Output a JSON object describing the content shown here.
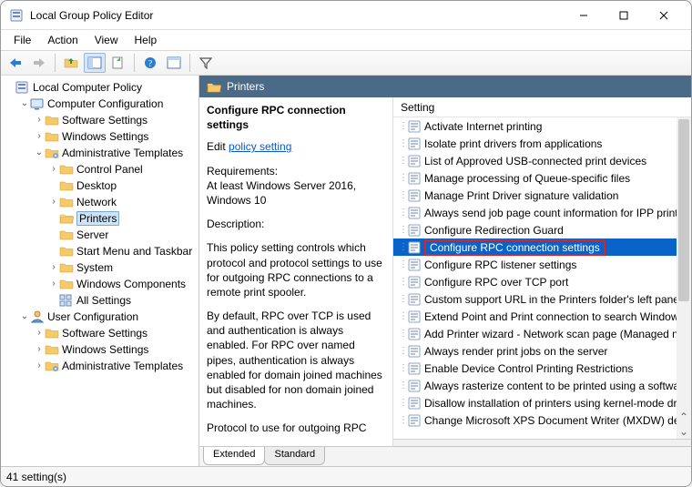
{
  "window": {
    "title": "Local Group Policy Editor"
  },
  "menu": {
    "items": [
      "File",
      "Action",
      "View",
      "Help"
    ]
  },
  "tree": {
    "root": "Local Computer Policy",
    "cc": "Computer Configuration",
    "cc_children": [
      "Software Settings",
      "Windows Settings"
    ],
    "at": "Administrative Templates",
    "at_children": [
      "Control Panel",
      "Desktop",
      "Network",
      "Printers",
      "Server",
      "Start Menu and Taskbar",
      "System",
      "Windows Components",
      "All Settings"
    ],
    "uc": "User Configuration",
    "uc_children": [
      "Software Settings",
      "Windows Settings",
      "Administrative Templates"
    ]
  },
  "header": {
    "path": "Printers"
  },
  "description": {
    "title": "Configure RPC connection settings",
    "edit_prefix": "Edit ",
    "edit_link": "policy setting",
    "req_label": "Requirements:",
    "req_text": "At least Windows Server 2016, Windows 10",
    "desc_label": "Description:",
    "p1": "This policy setting controls which protocol and protocol settings to use for outgoing RPC connections to a remote print spooler.",
    "p2": "By default, RPC over TCP is used and authentication is always enabled. For RPC over named pipes, authentication is always enabled for domain joined machines but disabled for non domain joined machines.",
    "p3": "Protocol to use for outgoing RPC"
  },
  "settings": {
    "column": "Setting",
    "items": [
      "Activate Internet printing",
      "Isolate print drivers from applications",
      "List of Approved USB-connected print devices",
      "Manage processing of Queue-specific files",
      "Manage Print Driver signature validation",
      "Always send job page count information for IPP print",
      "Configure Redirection Guard",
      "Configure RPC connection settings",
      "Configure RPC listener settings",
      "Configure RPC over TCP port",
      "Custom support URL in the Printers folder's left pane",
      "Extend Point and Print connection to search Window",
      "Add Printer wizard - Network scan page (Managed ne",
      "Always render print jobs on the server",
      "Enable Device Control Printing Restrictions",
      "Always rasterize content to be printed using a softwar",
      "Disallow installation of printers using kernel-mode dr",
      "Change Microsoft XPS Document Writer (MXDW) def"
    ],
    "selected_index": 7
  },
  "tabs": {
    "extended": "Extended",
    "standard": "Standard"
  },
  "status": {
    "text": "41 setting(s)"
  }
}
